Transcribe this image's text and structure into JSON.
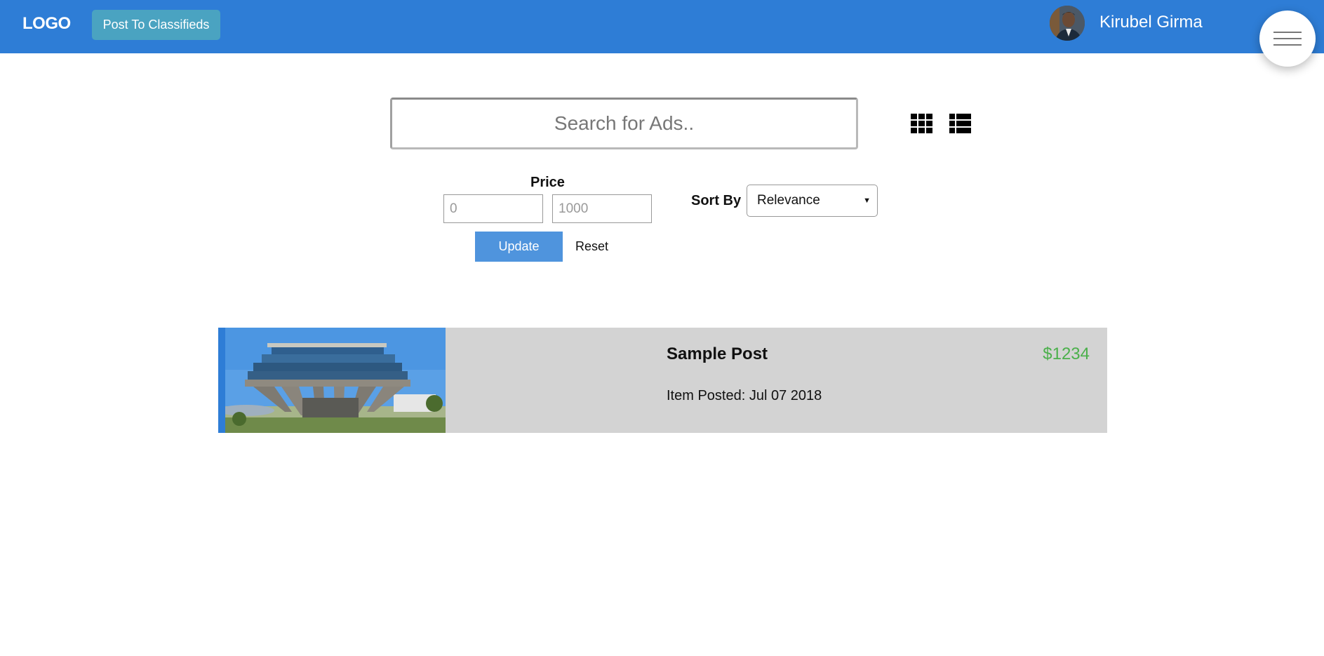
{
  "header": {
    "logo": "LOGO",
    "post_button": "Post To Classifieds",
    "user_name": "Kirubel Girma"
  },
  "search": {
    "placeholder": "Search for Ads.."
  },
  "filters": {
    "price_label": "Price",
    "min_placeholder": "0",
    "max_placeholder": "1000",
    "update_label": "Update",
    "reset_label": "Reset",
    "sort_label": "Sort By",
    "sort_selected": "Relevance"
  },
  "listings": [
    {
      "title": "Sample Post",
      "posted": "Item Posted: Jul 07 2018",
      "price": "$1234"
    }
  ],
  "colors": {
    "header": "#2e7dd6",
    "post_button": "#4aa3c1",
    "update_button": "#4f94dd",
    "listing_bg": "#d3d3d3",
    "price": "#4bb04b"
  },
  "icons": [
    "grid-view-icon",
    "list-view-icon",
    "hamburger-menu-icon"
  ]
}
